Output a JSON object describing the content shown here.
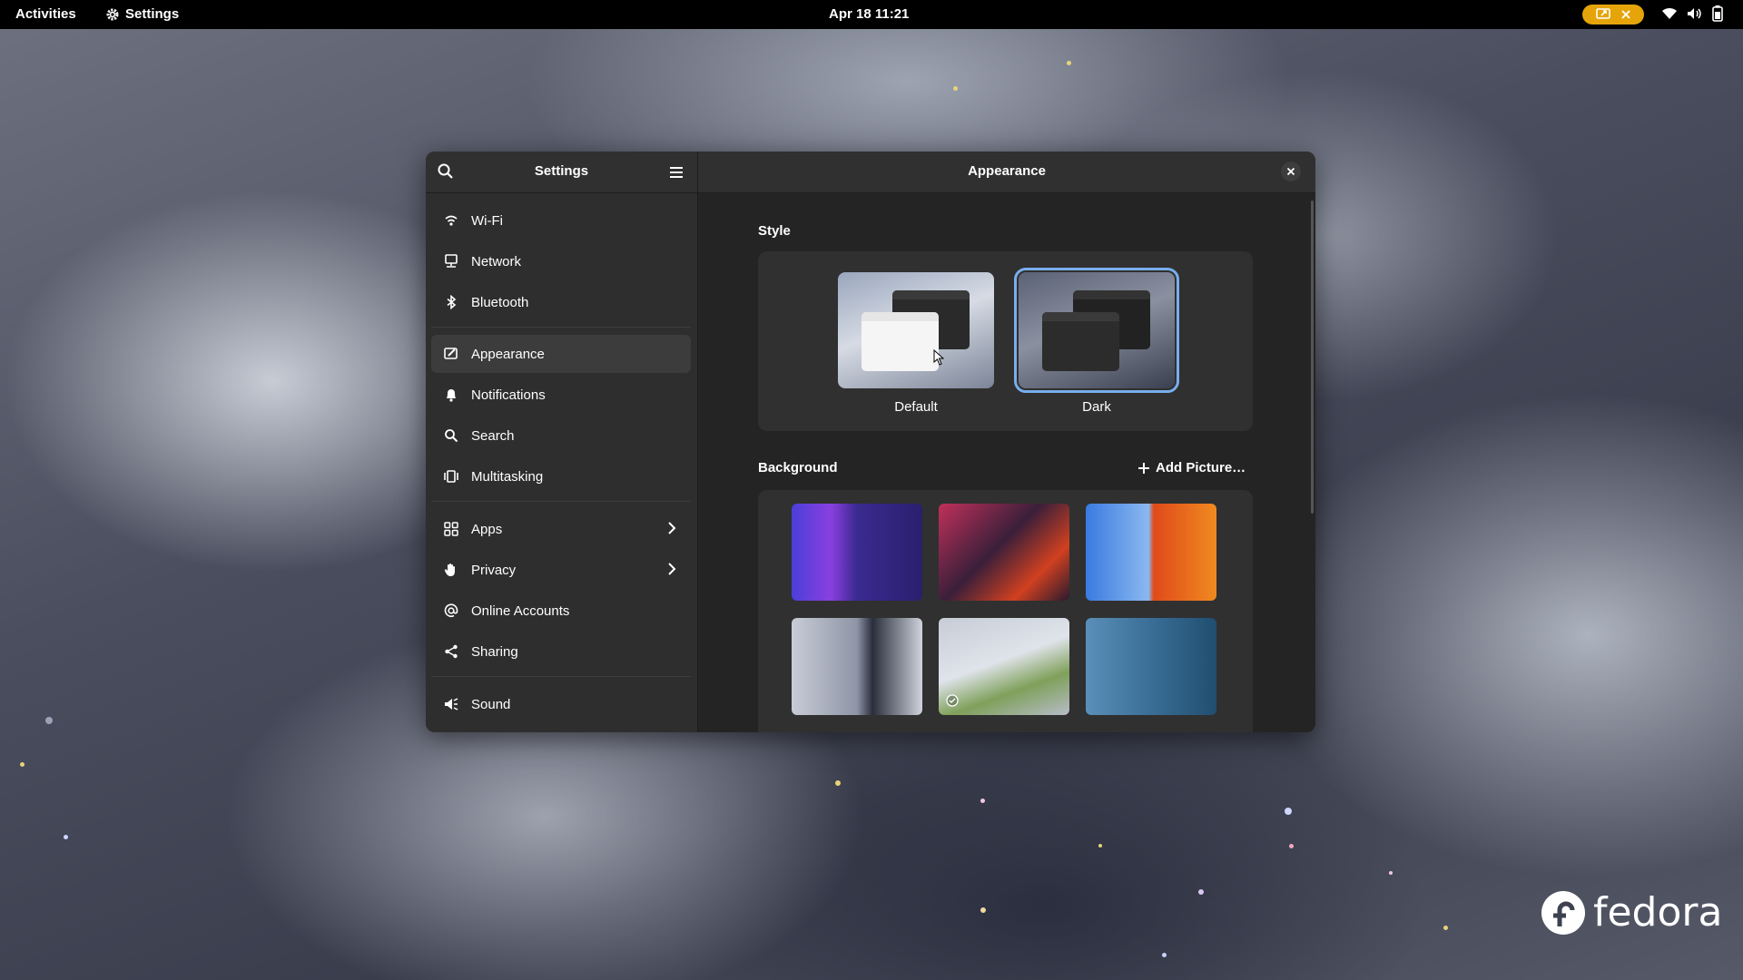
{
  "topbar": {
    "activities": "Activities",
    "app_name": "Settings",
    "clock": "Apr 18  11:21"
  },
  "sidebar": {
    "title": "Settings",
    "items": [
      {
        "label": "Wi-Fi",
        "icon": "wifi-icon"
      },
      {
        "label": "Network",
        "icon": "network-icon"
      },
      {
        "label": "Bluetooth",
        "icon": "bluetooth-icon"
      },
      {
        "label": "Appearance",
        "icon": "appearance-icon",
        "active": true
      },
      {
        "label": "Notifications",
        "icon": "bell-icon"
      },
      {
        "label": "Search",
        "icon": "search-icon"
      },
      {
        "label": "Multitasking",
        "icon": "multitasking-icon"
      },
      {
        "label": "Apps",
        "icon": "apps-icon",
        "has_submenu": true
      },
      {
        "label": "Privacy",
        "icon": "hand-icon",
        "has_submenu": true
      },
      {
        "label": "Online Accounts",
        "icon": "at-icon"
      },
      {
        "label": "Sharing",
        "icon": "share-icon"
      },
      {
        "label": "Sound",
        "icon": "speaker-icon"
      }
    ]
  },
  "content": {
    "title": "Appearance",
    "style_section": "Style",
    "style_options": [
      {
        "label": "Default",
        "selected": false
      },
      {
        "label": "Dark",
        "selected": true
      }
    ],
    "background_section": "Background",
    "add_picture": "Add Picture…",
    "selected_background_index": 4
  },
  "branding": {
    "logo_text": "fedora"
  },
  "colors": {
    "accent": "#78aeed",
    "indicator": "#e5a50a",
    "window_bg": "#242424",
    "sidebar_bg": "#2e2e2e"
  }
}
